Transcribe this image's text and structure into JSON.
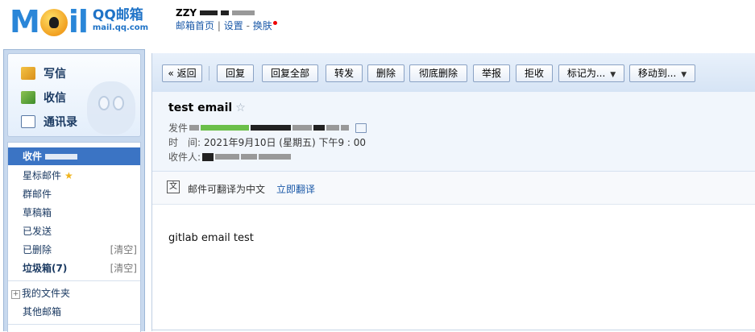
{
  "header": {
    "logo_mark": "M●il",
    "logo_name": "QQ邮箱",
    "logo_domain": "mail.qq.com",
    "user_name": "ZZY",
    "links": {
      "home": "邮箱首页",
      "divider": "|",
      "settings": "设置",
      "dash": "-",
      "skin": "换肤"
    }
  },
  "sidebar": {
    "actions": [
      {
        "label": "写信",
        "icon": "pencil-note-icon"
      },
      {
        "label": "收信",
        "icon": "inbox-download-icon"
      },
      {
        "label": "通讯录",
        "icon": "address-book-icon"
      }
    ],
    "folders": {
      "inbox": "收件",
      "starred": "星标邮件",
      "group": "群邮件",
      "drafts": "草稿箱",
      "sent": "已发送",
      "deleted": "已删除",
      "deleted_clear": "[清空]",
      "spam": "垃圾箱(7)",
      "spam_clear": "[清空]",
      "my_folders": "我的文件夹",
      "other": "其他邮箱"
    }
  },
  "toolbar": {
    "back": "« 返回",
    "reply": "回复",
    "reply_all": "回复全部",
    "forward": "转发",
    "delete": "删除",
    "perm_delete": "彻底删除",
    "report": "举报",
    "reject": "拒收",
    "mark_as": "标记为...",
    "move_to": "移动到..."
  },
  "mail": {
    "subject": "test email",
    "from_label": "发件",
    "time_label": "时　间:",
    "time_value": "2021年9月10日 (星期五) 下午9 : 00",
    "to_label": "收件人:",
    "body": "gitlab email test"
  },
  "translate": {
    "text": "邮件可翻译为中文",
    "link": "立即翻译"
  },
  "colors": {
    "accent": "#3b74c4",
    "link": "#1b59a8",
    "sidebar_bg": "#c8d9ee"
  }
}
